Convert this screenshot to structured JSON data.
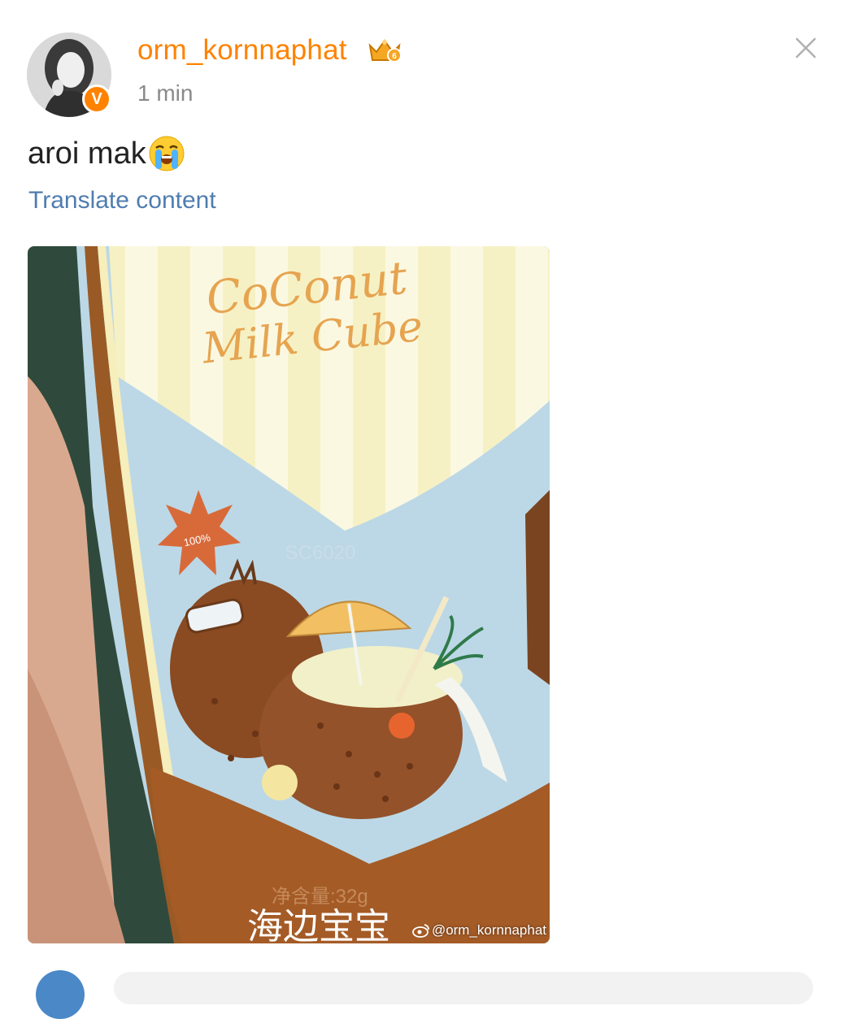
{
  "post": {
    "username": "orm_kornnaphat",
    "time": "1 min",
    "text": "aroi mak",
    "translate_label": "Translate content",
    "verified_badge": "V",
    "watermark": "@orm_kornnaphat"
  },
  "image": {
    "package_title_line1": "CoConut",
    "package_title_line2": "Milk Cube",
    "badge_text": "100%",
    "batch_code": "SC6020",
    "weight_text": "净含量:32g",
    "brand_text": "海边宝宝"
  },
  "colors": {
    "accent": "#ff8200",
    "link": "#507daf",
    "muted": "#8a8a8a"
  },
  "icons": {
    "crown": "crown-level-icon",
    "close": "close-icon",
    "emoji": "loudly-crying-face-emoji",
    "watermark": "weibo-logo-icon"
  }
}
